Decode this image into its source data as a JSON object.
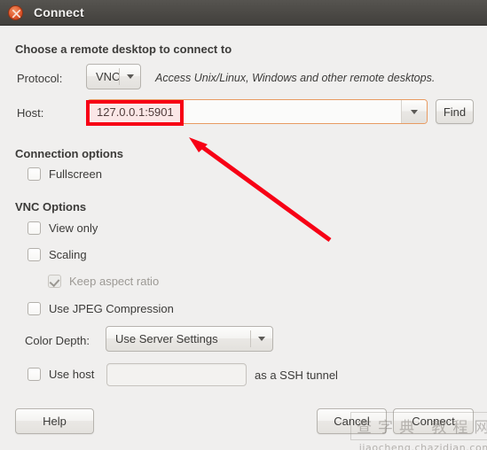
{
  "window": {
    "title": "Connect",
    "close_icon": "close-icon"
  },
  "main": {
    "heading": "Choose a remote desktop to connect to",
    "protocol": {
      "label": "Protocol:",
      "value": "VNC",
      "hint": "Access Unix/Linux, Windows and other remote desktops."
    },
    "host": {
      "label": "Host:",
      "value": "127.0.0.1:5901",
      "placeholder": "",
      "find_label": "Find"
    },
    "connection_options": {
      "heading": "Connection options",
      "items": [
        {
          "label": "Fullscreen",
          "checked": false,
          "disabled": false
        }
      ]
    },
    "vnc_options": {
      "heading": "VNC Options",
      "items": [
        {
          "label": "View only",
          "checked": false,
          "disabled": false
        },
        {
          "label": "Scaling",
          "checked": false,
          "disabled": false
        },
        {
          "label": "Keep aspect ratio",
          "checked": true,
          "disabled": true
        },
        {
          "label": "Use JPEG Compression",
          "checked": false,
          "disabled": false
        }
      ],
      "color_depth": {
        "label": "Color Depth:",
        "value": "Use Server Settings"
      },
      "ssh_tunnel": {
        "checkbox_label": "Use host",
        "checked": false,
        "host_value": "",
        "suffix_label": "as a SSH tunnel"
      }
    }
  },
  "footer": {
    "help_label": "Help",
    "cancel_label": "Cancel",
    "connect_label": "Connect"
  },
  "annotations": {
    "highlight_color": "#f70015",
    "arrow_color": "#f70015"
  },
  "watermark": {
    "cn_text": "查字典 教程网",
    "url_text": "jiaocheng.chazidian.com"
  }
}
